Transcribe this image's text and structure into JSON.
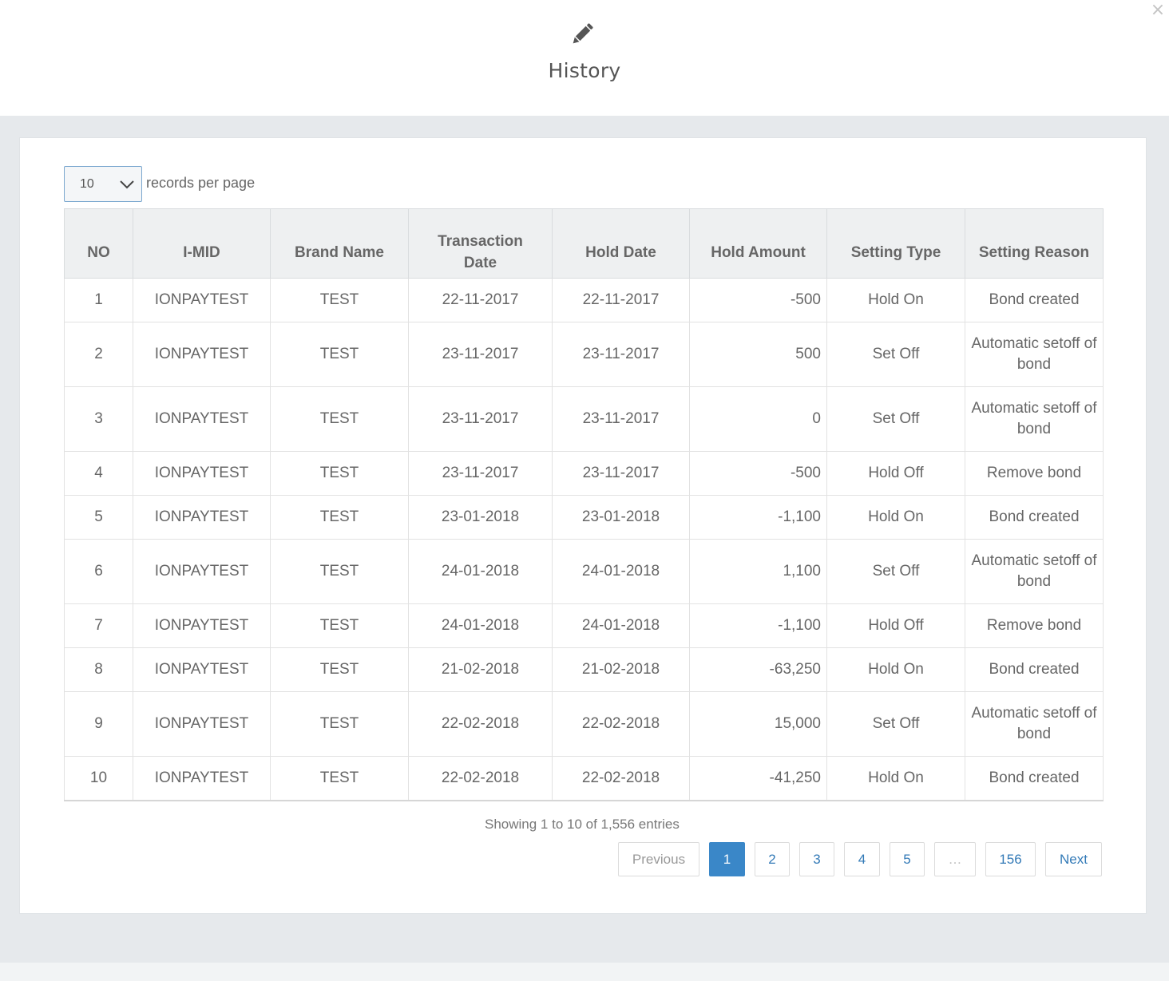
{
  "modal": {
    "title": "History",
    "close_label": "×",
    "icon": "pencil-icon"
  },
  "length_menu": {
    "selected": "10",
    "label": "records per page"
  },
  "table": {
    "headers": [
      "NO",
      "I-MID",
      "Brand Name",
      "Transaction Date",
      "Hold Date",
      "Hold Amount",
      "Setting Type",
      "Setting Reason"
    ],
    "rows": [
      {
        "no": "1",
        "imid": "IONPAYTEST",
        "brand": "TEST",
        "txn_date": "22-11-2017",
        "hold_date": "22-11-2017",
        "amount": "-500",
        "type": "Hold On",
        "reason": "Bond created"
      },
      {
        "no": "2",
        "imid": "IONPAYTEST",
        "brand": "TEST",
        "txn_date": "23-11-2017",
        "hold_date": "23-11-2017",
        "amount": "500",
        "type": "Set Off",
        "reason": "Automatic setoff of bond"
      },
      {
        "no": "3",
        "imid": "IONPAYTEST",
        "brand": "TEST",
        "txn_date": "23-11-2017",
        "hold_date": "23-11-2017",
        "amount": "0",
        "type": "Set Off",
        "reason": "Automatic setoff of bond"
      },
      {
        "no": "4",
        "imid": "IONPAYTEST",
        "brand": "TEST",
        "txn_date": "23-11-2017",
        "hold_date": "23-11-2017",
        "amount": "-500",
        "type": "Hold Off",
        "reason": "Remove bond"
      },
      {
        "no": "5",
        "imid": "IONPAYTEST",
        "brand": "TEST",
        "txn_date": "23-01-2018",
        "hold_date": "23-01-2018",
        "amount": "-1,100",
        "type": "Hold On",
        "reason": "Bond created"
      },
      {
        "no": "6",
        "imid": "IONPAYTEST",
        "brand": "TEST",
        "txn_date": "24-01-2018",
        "hold_date": "24-01-2018",
        "amount": "1,100",
        "type": "Set Off",
        "reason": "Automatic setoff of bond"
      },
      {
        "no": "7",
        "imid": "IONPAYTEST",
        "brand": "TEST",
        "txn_date": "24-01-2018",
        "hold_date": "24-01-2018",
        "amount": "-1,100",
        "type": "Hold Off",
        "reason": "Remove bond"
      },
      {
        "no": "8",
        "imid": "IONPAYTEST",
        "brand": "TEST",
        "txn_date": "21-02-2018",
        "hold_date": "21-02-2018",
        "amount": "-63,250",
        "type": "Hold On",
        "reason": "Bond created"
      },
      {
        "no": "9",
        "imid": "IONPAYTEST",
        "brand": "TEST",
        "txn_date": "22-02-2018",
        "hold_date": "22-02-2018",
        "amount": "15,000",
        "type": "Set Off",
        "reason": "Automatic setoff of bond"
      },
      {
        "no": "10",
        "imid": "IONPAYTEST",
        "brand": "TEST",
        "txn_date": "22-02-2018",
        "hold_date": "22-02-2018",
        "amount": "-41,250",
        "type": "Hold On",
        "reason": "Bond created"
      }
    ]
  },
  "info_text": "Showing 1 to 10 of 1,556 entries",
  "pagination": {
    "previous": "Previous",
    "next": "Next",
    "pages": [
      "1",
      "2",
      "3",
      "4",
      "5",
      "…",
      "156"
    ],
    "current": "1"
  },
  "colors": {
    "accent": "#3a87c8",
    "link": "#337ab7",
    "header_bg": "#eef0f1",
    "page_bg": "#e6e9ec"
  }
}
